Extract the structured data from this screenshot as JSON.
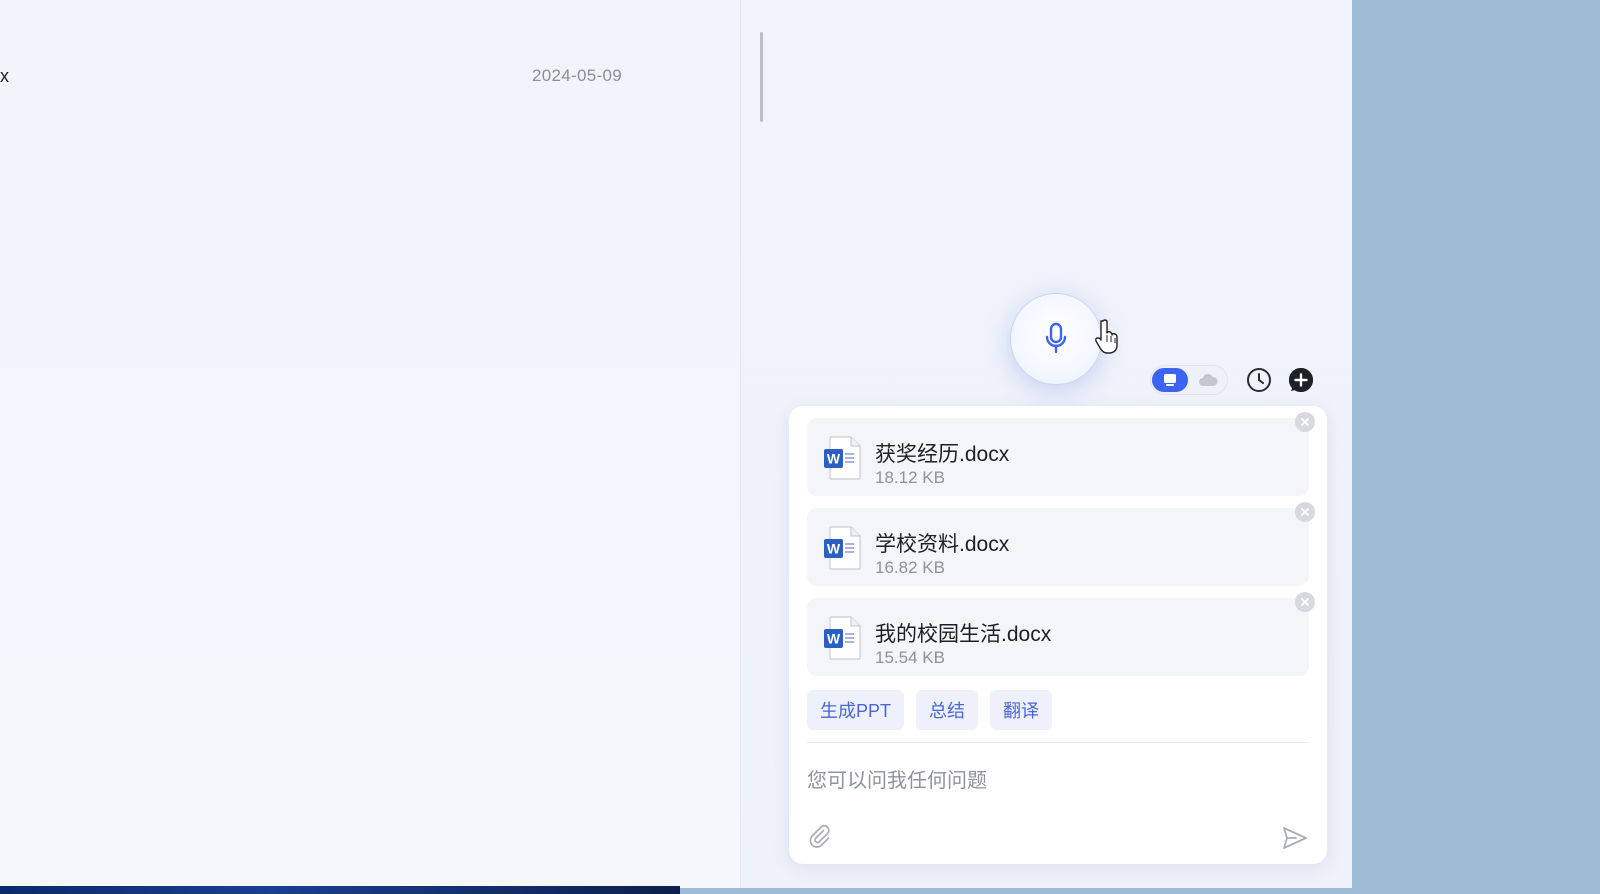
{
  "left_pane": {
    "file_row": {
      "name_fragment": "x",
      "date": "2024-05-09"
    }
  },
  "toolbar": {
    "toggle": {
      "active": "local-mode",
      "inactive": "cloud-mode"
    },
    "history_icon": "clock-icon",
    "add_icon": "plus-icon"
  },
  "chat": {
    "files": [
      {
        "name": "获奖经历.docx",
        "size": "18.12 KB"
      },
      {
        "name": "学校资料.docx",
        "size": "16.82 KB"
      },
      {
        "name": "我的校园生活.docx",
        "size": "15.54 KB"
      }
    ],
    "actions": [
      "生成PPT",
      "总结",
      "翻译"
    ],
    "input": {
      "placeholder": "您可以问我任何问题"
    }
  },
  "colors": {
    "accent": "#3d63f2",
    "chip_text": "#4b66d6",
    "chip_bg": "#eef1fb",
    "desktop": "#9dbdd6"
  }
}
